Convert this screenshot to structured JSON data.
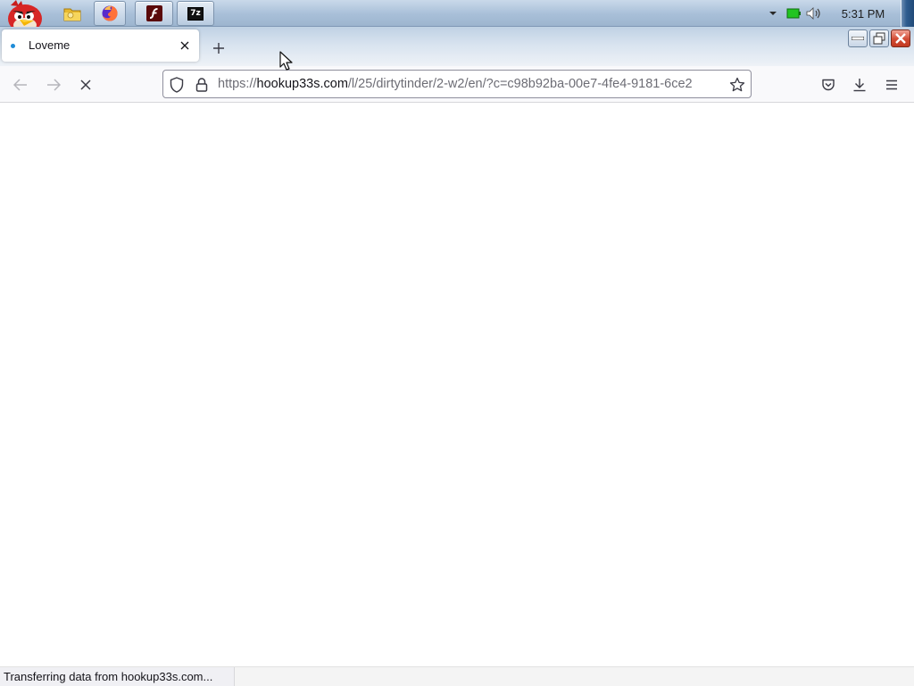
{
  "taskbar": {
    "start": {
      "icon": "angry-bird-start-orb-icon"
    },
    "pinned": [
      {
        "name": "folder",
        "icon": "folder-icon"
      },
      {
        "name": "firefox",
        "icon": "firefox-icon"
      },
      {
        "name": "flash",
        "icon": "flash-icon"
      },
      {
        "name": "7zip",
        "icon": "7zip-icon",
        "label": "7z"
      }
    ],
    "tray": {
      "overflow_icon": "chevron-down-icon",
      "battery_icon": "battery-icon",
      "volume_icon": "volume-icon",
      "clock": "5:31 PM"
    }
  },
  "browser": {
    "tab": {
      "title": "Loveme",
      "loading_indicator": "dot-icon",
      "close_icon": "close-icon"
    },
    "new_tab_icon": "plus-icon",
    "window_controls": [
      "minimize-icon",
      "restore-icon",
      "close-icon"
    ],
    "nav": {
      "back_icon": "back-arrow-icon",
      "forward_icon": "forward-arrow-icon",
      "stop_icon": "stop-icon"
    },
    "url": {
      "scheme": "https://",
      "host": "hookup33s.com",
      "path": "/l/25/dirtytinder/2-w2/en/?c=c98b92ba-00e7-4fe4-9181-6ce2",
      "shield_icon": "shield-icon",
      "lock_icon": "lock-icon",
      "bookmark_icon": "star-icon"
    },
    "toolbar": [
      "pocket-icon",
      "download-icon",
      "menu-icon"
    ],
    "status": "Transferring data from hookup33s.com..."
  },
  "colors": {
    "accent": "#1e8cd8",
    "taskbar_top": "#c9d9ea",
    "close_red": "#d24b33"
  }
}
